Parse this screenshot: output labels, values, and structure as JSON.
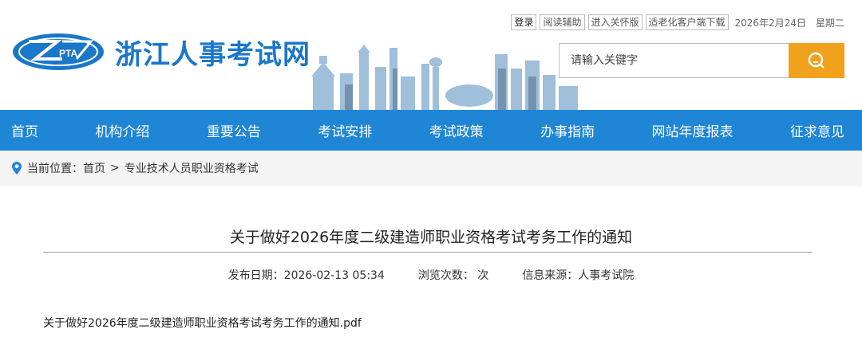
{
  "topbar": {
    "login": "登录",
    "reading_aid": "阅读辅助",
    "care_version": "进入关怀版",
    "elderly_client": "适老化客户端下载",
    "date": "2026年2月24日",
    "weekday": "星期二"
  },
  "logo": {
    "badge_text": "PTA",
    "site_title": "浙江人事考试网"
  },
  "search": {
    "placeholder": "请输入关键字",
    "button_icon": "search-icon"
  },
  "nav": {
    "items": [
      "首页",
      "机构介绍",
      "重要公告",
      "考试安排",
      "考试政策",
      "办事指南",
      "网站年度报表",
      "征求意见"
    ]
  },
  "breadcrumb": {
    "label": "当前位置：",
    "home": "首页",
    "separator": ">",
    "current": "专业技术人员职业资格考试"
  },
  "article": {
    "title": "关于做好2026年度二级建造师职业资格考试考务工作的通知",
    "publish_date": "发布日期：2026-02-13 05:34",
    "views": "浏览次数：  次",
    "source": "信息来源：人事考试院",
    "attachment": "关于做好2026年度二级建造师职业资格考试考务工作的通知.pdf"
  },
  "colors": {
    "brand_blue": "#1f86d5",
    "search_orange": "#f0a21c"
  }
}
